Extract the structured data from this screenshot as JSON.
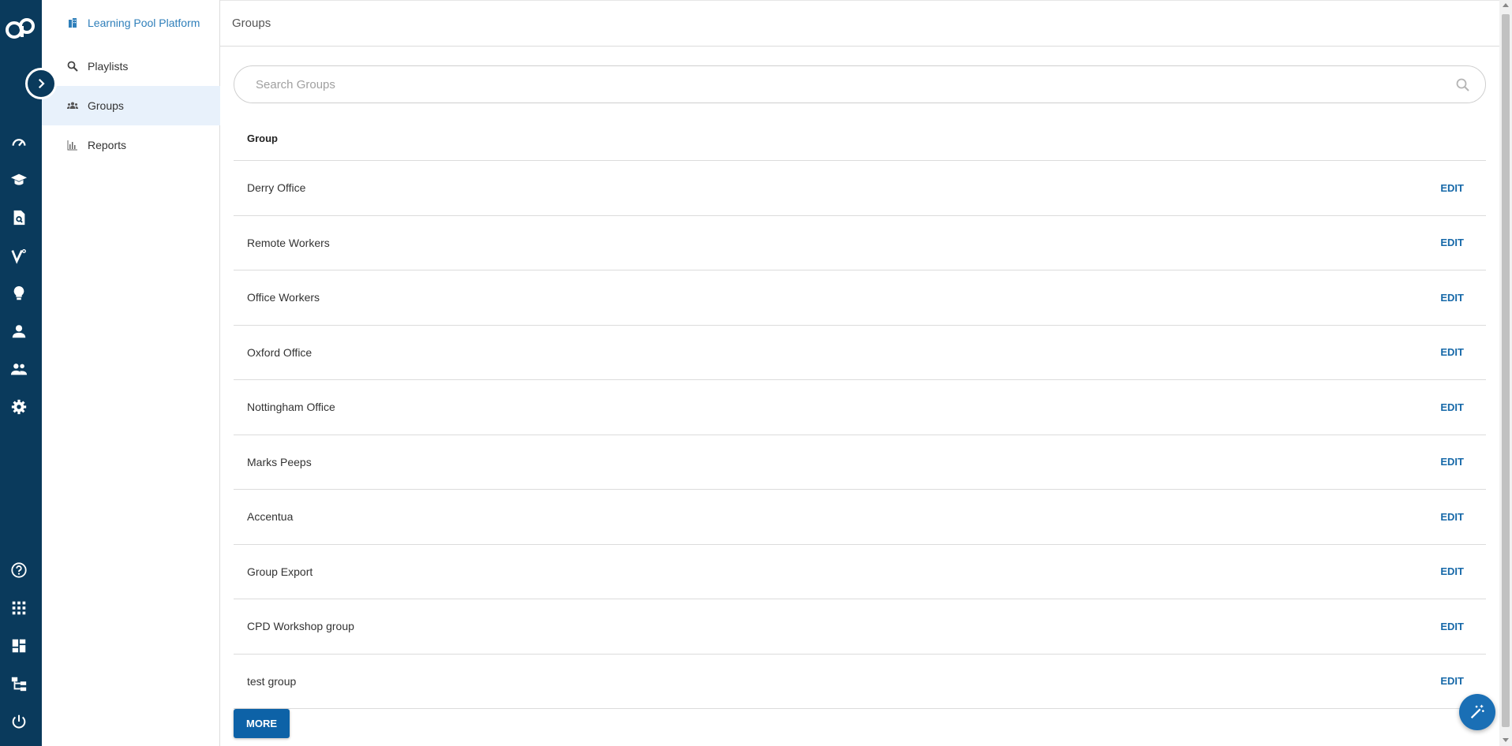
{
  "colors": {
    "rail_bg": "#0a3a5c",
    "accent": "#1668a8",
    "active_nav_bg": "#e8f1fb"
  },
  "rail": {
    "icons": [
      "logo-icon",
      "dashboard-icon",
      "learning-icon",
      "document-search-icon",
      "v-brand-icon",
      "lightbulb-icon",
      "user-icon",
      "people-icon",
      "gear-icon",
      "help-icon",
      "apps-grid-icon",
      "layout-icon",
      "hierarchy-icon",
      "power-icon"
    ]
  },
  "subnav": {
    "platform_label": "Learning Pool Platform",
    "playlists_label": "Playlists",
    "groups_label": "Groups",
    "reports_label": "Reports"
  },
  "header": {
    "title": "Groups"
  },
  "search": {
    "placeholder": "Search Groups"
  },
  "table": {
    "column_header": "Group",
    "action_label": "EDIT",
    "rows": [
      "Derry Office",
      "Remote Workers",
      "Office Workers",
      "Oxford Office",
      "Nottingham Office",
      "Marks Peeps",
      "Accentua",
      "Group Export",
      "CPD Workshop group",
      "test group"
    ]
  },
  "more_label": "MORE"
}
